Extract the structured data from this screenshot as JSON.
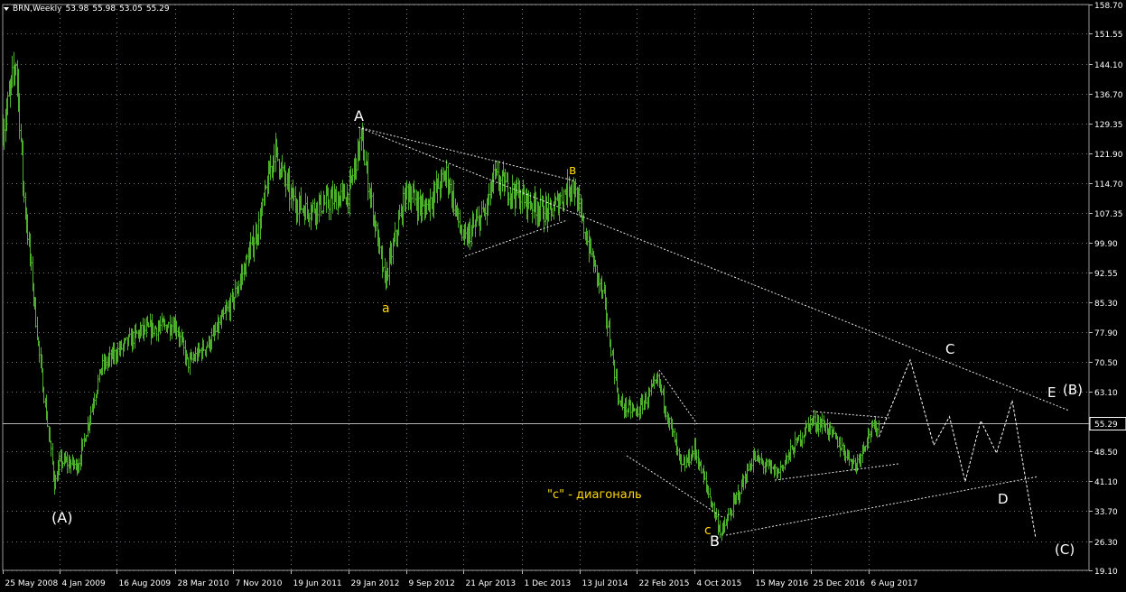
{
  "header": {
    "symbol": "BRN,Weekly",
    "open": "53.98",
    "high": "55.98",
    "low": "53.05",
    "close": "55.29"
  },
  "colors": {
    "background": "#000000",
    "bars": "#4caf2a",
    "grid": "#6e7480",
    "axis_text": "#ffffff",
    "wave_white": "#ffffff",
    "wave_yellow": "#ffd800",
    "price_marker_bg": "#000000"
  },
  "chart_data": {
    "type": "ohlc",
    "timeframe": "Weekly",
    "ylim": [
      19.1,
      158.7
    ],
    "y_ticks": [
      "158.70",
      "151.55",
      "144.10",
      "136.70",
      "129.35",
      "121.90",
      "114.70",
      "107.35",
      "99.90",
      "92.55",
      "85.30",
      "77.90",
      "70.50",
      "63.10",
      "55.29",
      "48.50",
      "41.10",
      "33.70",
      "26.30",
      "19.10"
    ],
    "x_tick_labels": [
      "25 May 2008",
      "4 Jan 2009",
      "16 Aug 2009",
      "28 Mar 2010",
      "7 Nov 2010",
      "19 Jun 2011",
      "29 Jan 2012",
      "9 Sep 2012",
      "21 Apr 2013",
      "1 Dec 2013",
      "13 Jul 2014",
      "22 Feb 2015",
      "4 Oct 2015",
      "15 May 2016",
      "25 Dec 2016",
      "6 Aug 2017"
    ],
    "current_price": "55.29",
    "price_path": [
      [
        "25 May 2008",
        128
      ],
      [
        "Jul 2008",
        145
      ],
      [
        "Aug 2008",
        112
      ],
      [
        "Oct 2008",
        72
      ],
      [
        "Dec 2008",
        40
      ],
      [
        "4 Jan 2009",
        46
      ],
      [
        "Mar 2009",
        45
      ],
      [
        "Jun 2009",
        69
      ],
      [
        "16 Aug 2009",
        73
      ],
      [
        "Nov 2009",
        78
      ],
      [
        "28 Mar 2010",
        80
      ],
      [
        "May 2010",
        70
      ],
      [
        "Aug 2010",
        76
      ],
      [
        "7 Nov 2010",
        86
      ],
      [
        "Feb 2011",
        104
      ],
      [
        "Apr 2011",
        123
      ],
      [
        "19 Jun 2011",
        111
      ],
      [
        "Aug 2011",
        108
      ],
      [
        "Nov 2011",
        110
      ],
      [
        "29 Jan 2012",
        112
      ],
      [
        "Mar 2012",
        126
      ],
      [
        "Jun 2012",
        90
      ],
      [
        "9 Sep 2012",
        113
      ],
      [
        "Nov 2012",
        108
      ],
      [
        "Feb 2013",
        117
      ],
      [
        "21 Apr 2013",
        100
      ],
      [
        "Jul 2013",
        108
      ],
      [
        "Aug 2013",
        116
      ],
      [
        "1 Dec 2013",
        111
      ],
      [
        "Mar 2014",
        107
      ],
      [
        "Jun 2014",
        115
      ],
      [
        "13 Jul 2014",
        107
      ],
      [
        "Oct 2014",
        86
      ],
      [
        "Dec 2014",
        60
      ],
      [
        "22 Feb 2015",
        58
      ],
      [
        "May 2015",
        66
      ],
      [
        "Aug 2015",
        44
      ],
      [
        "4 Oct 2015",
        49
      ],
      [
        "Jan 2016",
        28
      ],
      [
        "15 May 2016",
        47
      ],
      [
        "Aug 2016",
        43
      ],
      [
        "25 Dec 2016",
        56
      ],
      [
        "Feb 2017",
        55
      ],
      [
        "Jun 2017",
        45
      ],
      [
        "6 Aug 2017",
        53
      ],
      [
        "Sep 2017",
        55
      ]
    ],
    "projection_path": [
      [
        "Sep 2017",
        52
      ],
      [
        "Jan 2018",
        71
      ],
      [
        "Apr 2018",
        50
      ],
      [
        "Jun 2018",
        57
      ],
      [
        "Aug 2018",
        41
      ],
      [
        "Oct 2018",
        56
      ],
      [
        "Dec 2018",
        48
      ],
      [
        "Feb 2019",
        61
      ],
      [
        "May 2019",
        27
      ]
    ],
    "wave_labels_white": [
      "A",
      "(A)",
      "B",
      "C",
      "D",
      "E",
      "(B)",
      "(C)"
    ],
    "wave_labels_yellow": [
      "a",
      "в",
      "c"
    ],
    "annotation": "\"c\" - диагональ"
  }
}
